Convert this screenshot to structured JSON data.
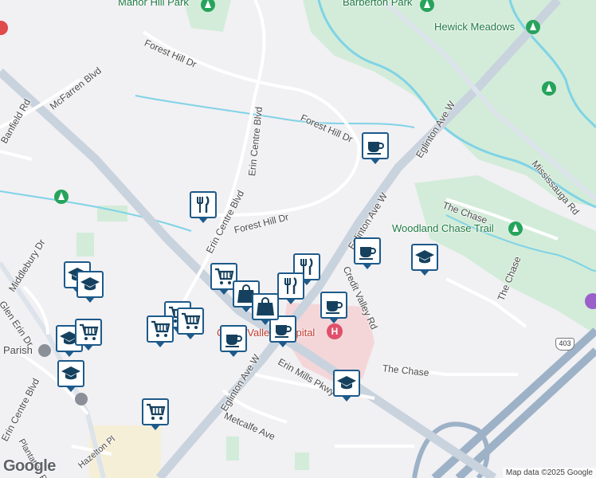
{
  "map": {
    "colors": {
      "background": "#f1f0f3",
      "park": "#d2ecd9",
      "water": "#7fd3e6",
      "highway": "#9db2c7",
      "arterial": "#c9d3de",
      "hospital_area": "#f4d6d9",
      "marker_border": "#1d5a8a",
      "marker_glyph": "#15415f"
    },
    "street_labels": [
      {
        "id": "forest-hill-dr-north",
        "text": "Forest Hill Dr"
      },
      {
        "id": "forest-hill-dr-east",
        "text": "Forest Hill Dr"
      },
      {
        "id": "forest-hill-dr-south",
        "text": "Forest Hill Dr"
      },
      {
        "id": "mcfarren-blvd",
        "text": "McFarren Blvd"
      },
      {
        "id": "banfield-rd",
        "text": "Banfield Rd"
      },
      {
        "id": "erin-centre-blvd-north",
        "text": "Erin Centre Blvd"
      },
      {
        "id": "erin-centre-blvd-mid",
        "text": "Erin Centre Blvd"
      },
      {
        "id": "erin-centre-blvd-south",
        "text": "Erin Centre Blvd"
      },
      {
        "id": "eglinton-ave-w-north",
        "text": "Eglinton Ave W"
      },
      {
        "id": "eglinton-ave-w-mid",
        "text": "Eglinton Ave W"
      },
      {
        "id": "eglinton-ave-w-south",
        "text": "Eglinton Ave W"
      },
      {
        "id": "credit-valley-rd",
        "text": "Credit Valley Rd"
      },
      {
        "id": "the-chase-north",
        "text": "The Chase"
      },
      {
        "id": "the-chase-east",
        "text": "The Chase"
      },
      {
        "id": "the-chase-south",
        "text": "The Chase"
      },
      {
        "id": "mississauga-rd",
        "text": "Mississauga Rd"
      },
      {
        "id": "middlebury-dr",
        "text": "Middlebury Dr"
      },
      {
        "id": "glen-erin-dr",
        "text": "Glen Erin Dr"
      },
      {
        "id": "erin-mills-pkwy",
        "text": "Erin Mills Pkwy"
      },
      {
        "id": "metcalfe-ave",
        "text": "Metcalfe Ave"
      },
      {
        "id": "plantation-pl",
        "text": "Plantation Pl"
      },
      {
        "id": "hazelton-pl",
        "text": "Hazelton Pl"
      }
    ],
    "place_labels": [
      {
        "id": "manor-hill-park",
        "text": "Manor Hill Park"
      },
      {
        "id": "barberton-park",
        "text": "Barberton Park"
      },
      {
        "id": "hewick-meadows",
        "text": "Hewick Meadows"
      },
      {
        "id": "woodland-chase-trail",
        "text": "Woodland Chase Trail"
      },
      {
        "id": "parish",
        "text": "Parish"
      },
      {
        "id": "credit-valley-hospital",
        "text": "Credit Valley Hospital"
      }
    ],
    "highway_shield": "403",
    "markers": [
      {
        "id": "cafe-1",
        "type": "cafe-icon"
      },
      {
        "id": "cafe-2",
        "type": "cafe-icon"
      },
      {
        "id": "cafe-3",
        "type": "cafe-icon"
      },
      {
        "id": "cafe-4",
        "type": "cafe-icon"
      },
      {
        "id": "cafe-5",
        "type": "cafe-icon"
      },
      {
        "id": "restaurant-1",
        "type": "restaurant-icon"
      },
      {
        "id": "restaurant-2",
        "type": "restaurant-icon"
      },
      {
        "id": "restaurant-3",
        "type": "restaurant-icon"
      },
      {
        "id": "school-1",
        "type": "school-icon"
      },
      {
        "id": "school-2",
        "type": "school-icon"
      },
      {
        "id": "school-3",
        "type": "school-icon"
      },
      {
        "id": "school-4",
        "type": "school-icon"
      },
      {
        "id": "school-5",
        "type": "school-icon"
      },
      {
        "id": "school-6",
        "type": "school-icon"
      },
      {
        "id": "grocery-1",
        "type": "grocery-cart-icon"
      },
      {
        "id": "grocery-2",
        "type": "grocery-cart-icon"
      },
      {
        "id": "grocery-3",
        "type": "grocery-cart-icon"
      },
      {
        "id": "grocery-4",
        "type": "grocery-cart-icon"
      },
      {
        "id": "grocery-5",
        "type": "grocery-cart-icon"
      },
      {
        "id": "grocery-6",
        "type": "grocery-cart-icon"
      },
      {
        "id": "shopping-1",
        "type": "shopping-bag-icon"
      },
      {
        "id": "shopping-2",
        "type": "shopping-bag-icon"
      }
    ],
    "logo": "Google",
    "attribution": "Map data ©2025 Google"
  }
}
